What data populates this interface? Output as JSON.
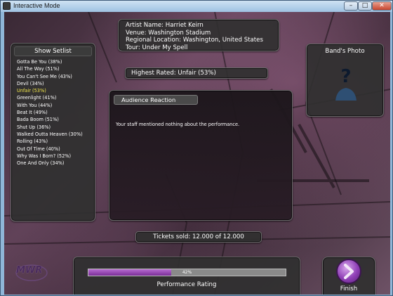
{
  "window": {
    "title": "Interactive Mode",
    "controls": {
      "minimize": "–",
      "maximize": "□",
      "close": "✕"
    }
  },
  "info": {
    "artist": "Artist Name: Harriet Keirn",
    "venue": "Venue: Washington Stadium",
    "location": "Regional Location: Washington, United States",
    "tour": "Tour: Under My Spell"
  },
  "setlist": {
    "title": "Show Setlist",
    "items": [
      {
        "label": "Gotta Be You (38%)",
        "selected": false
      },
      {
        "label": "All The Way (51%)",
        "selected": false
      },
      {
        "label": "You Can't See Me (43%)",
        "selected": false
      },
      {
        "label": "Devil (34%)",
        "selected": false
      },
      {
        "label": "Unfair (53%)",
        "selected": true
      },
      {
        "label": "Greenlight (41%)",
        "selected": false
      },
      {
        "label": "With You (44%)",
        "selected": false
      },
      {
        "label": "Beat It (49%)",
        "selected": false
      },
      {
        "label": "Bada Boom (51%)",
        "selected": false
      },
      {
        "label": "Shut Up (36%)",
        "selected": false
      },
      {
        "label": "Walked Outta Heaven (30%)",
        "selected": false
      },
      {
        "label": "Rolling (43%)",
        "selected": false
      },
      {
        "label": "Out Of Time (40%)",
        "selected": false
      },
      {
        "label": "Why Was I Born? (52%)",
        "selected": false
      },
      {
        "label": "One And Only (34%)",
        "selected": false
      }
    ]
  },
  "highest_rated": "Highest Rated: Unfair (53%)",
  "band_photo": {
    "title": "Band's Photo",
    "icon": "unknown-person-icon"
  },
  "reaction": {
    "title": "Audience Reaction",
    "message": "Your staff mentioned nothing about the performance."
  },
  "tickets": "Tickets sold:  12.000 of 12.000",
  "performance": {
    "label": "Performance Rating",
    "percent_text": "42%",
    "value": 0.42,
    "fill_color": "#8f3fb6"
  },
  "finish": {
    "label": "Finish",
    "icon": "chevron-right-icon"
  },
  "logo": {
    "text": "MWR"
  },
  "colors": {
    "selected_item": "#f4e94a",
    "accent": "#8f3fb6"
  }
}
